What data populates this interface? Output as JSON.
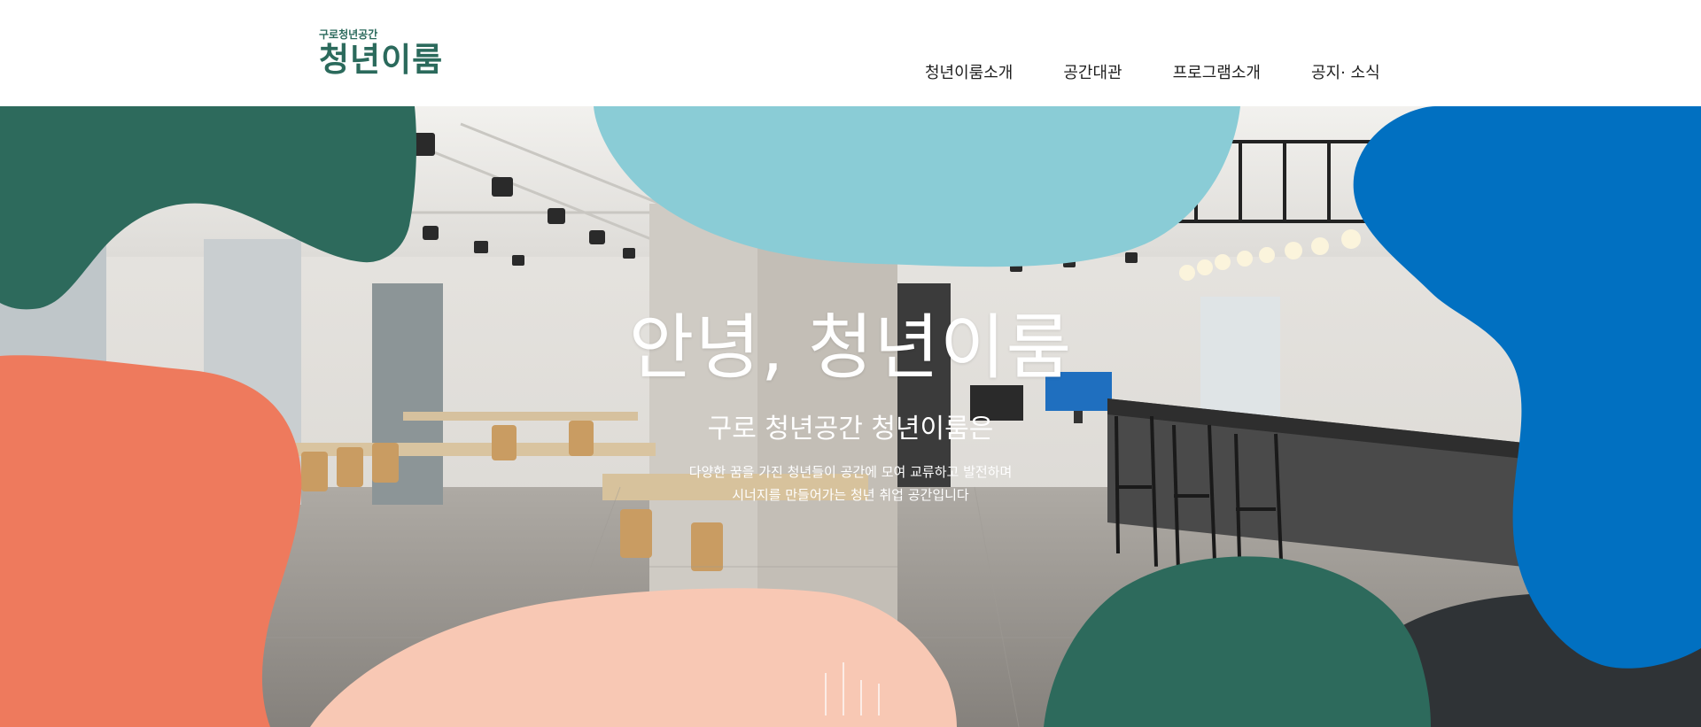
{
  "logo": {
    "small": "구로청년공간",
    "big": "청년이룸"
  },
  "nav": {
    "items": [
      {
        "label": "청년이룸소개"
      },
      {
        "label": "공간대관"
      },
      {
        "label": "프로그램소개"
      },
      {
        "label": "공지· 소식"
      }
    ]
  },
  "hero": {
    "title": "안녕, 청년이룸",
    "subtitle": "구로 청년공간 청년이룸은",
    "description_line1": "다양한 꿈을 가진 청년들이 공간에 모여 교류하고 발전하며",
    "description_line2": "시너지를 만들어가는 청년 취업 공간입니다"
  },
  "colors": {
    "brand_green": "#2b6a5c",
    "cyan_blob": "#8accd6",
    "blue_blob": "#0170c1",
    "coral_blob": "#ee7a5d",
    "peach_blob": "#f8c8b4",
    "dark_green_blob": "#2d6a5c"
  }
}
